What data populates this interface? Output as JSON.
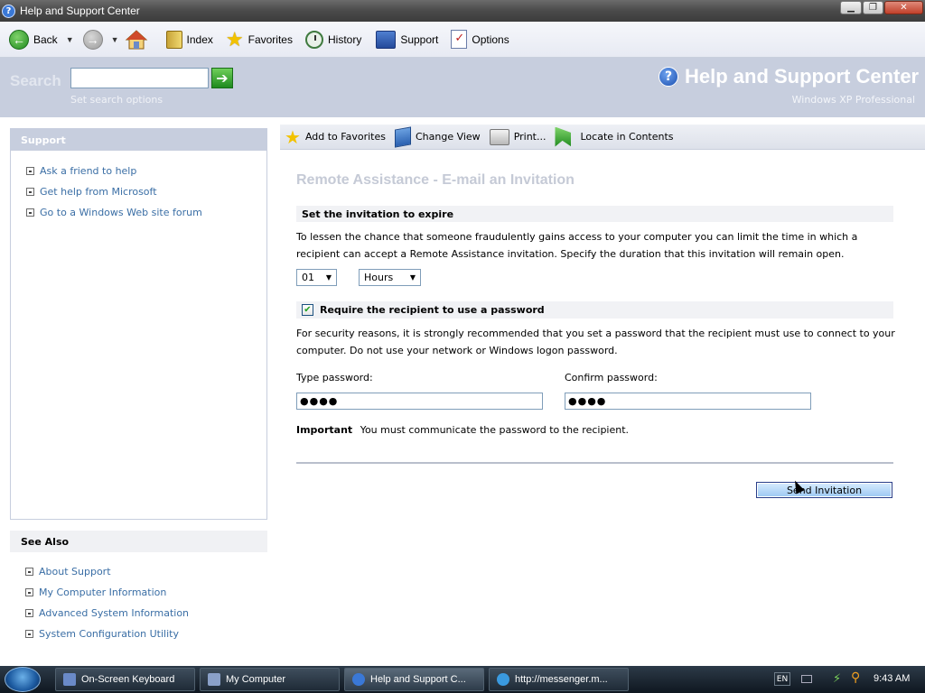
{
  "window": {
    "title": "Help and Support Center"
  },
  "toolbar": {
    "back": "Back",
    "index": "Index",
    "favorites": "Favorites",
    "history": "History",
    "support": "Support",
    "options": "Options"
  },
  "header": {
    "search_label": "Search",
    "search_value": "",
    "search_options": "Set search options",
    "title": "Help and Support Center",
    "subtitle": "Windows XP Professional"
  },
  "left_pane": {
    "heading": "Support",
    "links": [
      "Ask a friend to help",
      "Get help from Microsoft",
      "Go to a Windows Web site forum"
    ]
  },
  "see_also": {
    "heading": "See Also",
    "links": [
      "About Support",
      "My Computer Information",
      "Advanced System Information",
      "System Configuration Utility"
    ]
  },
  "content_toolbar": {
    "add_favorites": "Add to Favorites",
    "change_view": "Change View",
    "print": "Print...",
    "locate": "Locate in Contents"
  },
  "content": {
    "heading": "Remote Assistance - E-mail an Invitation",
    "expire_section": "Set the invitation to expire",
    "expire_text": "To lessen the chance that someone fraudulently gains access to your computer you can limit the time in which a recipient can accept a Remote Assistance invitation. Specify the duration that this invitation will remain open.",
    "duration_value": "01",
    "duration_unit": "Hours",
    "password_section": "Require the recipient to use a password",
    "password_checked": true,
    "password_text": "For security reasons, it is strongly recommended that you set a password that the recipient must use to connect to your computer. Do not use your network or Windows logon password.",
    "type_password_label": "Type password:",
    "type_password_value": "●●●●",
    "confirm_password_label": "Confirm password:",
    "confirm_password_value": "●●●●",
    "important_label": "Important",
    "important_text": "You must communicate the password to the recipient.",
    "send_button": "Send Invitation"
  },
  "taskbar": {
    "tasks": [
      "On-Screen Keyboard",
      "My Computer",
      "Help and Support C...",
      "http://messenger.m..."
    ],
    "language": "EN",
    "clock": "9:43 AM"
  },
  "colors": {
    "link": "#3a6ea5",
    "header_band": "#c7cede",
    "taskbar": "#1f2b37"
  }
}
